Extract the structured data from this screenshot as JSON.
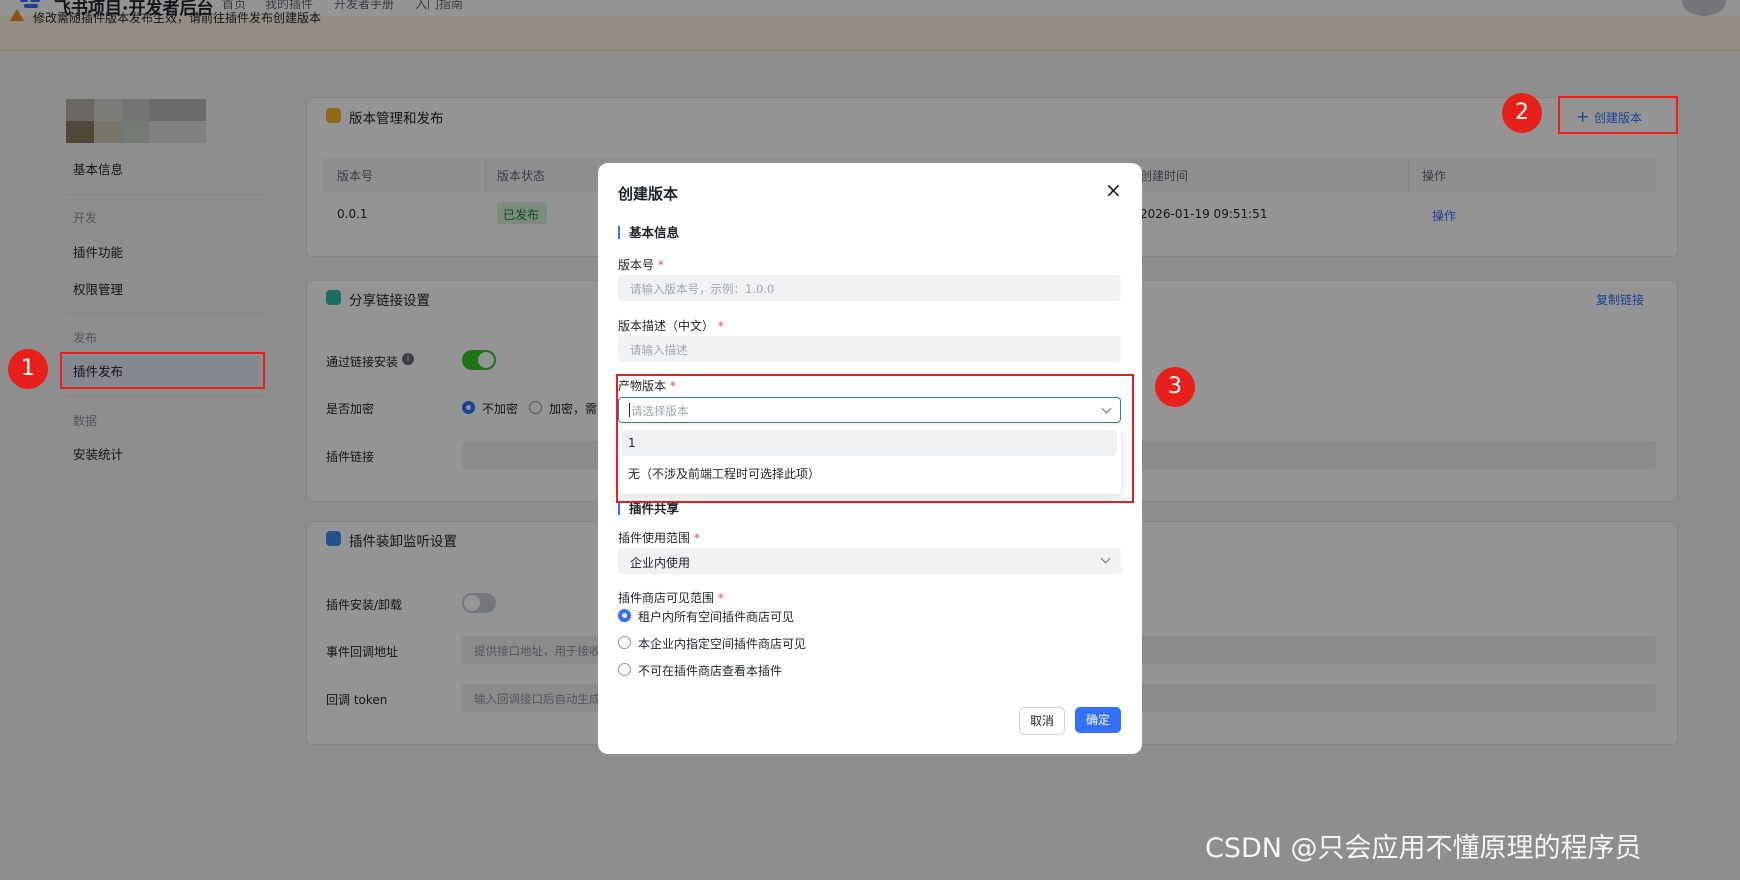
{
  "header": {
    "app_title": "飞书项目·开发者后台",
    "nav": [
      "首页",
      "我的插件",
      "开发者手册",
      "入门指南"
    ]
  },
  "notice": {
    "text": "修改需随插件版本发布生效，请前往插件发布创建版本"
  },
  "sidebar": {
    "basic_info": "基本信息",
    "group_dev": "开发",
    "plugin_function": "插件功能",
    "permission": "权限管理",
    "group_publish": "发布",
    "plugin_publish": "插件发布",
    "group_data": "数据",
    "install_stats": "安装统计"
  },
  "version_card": {
    "title": "版本管理和发布",
    "create_button": "创建版本",
    "columns": [
      "版本号",
      "版本状态",
      "创建时间",
      "操作"
    ],
    "row": {
      "version": "0.0.1",
      "status": "已发布",
      "created": "2026-01-19 09:51:51",
      "action": "操作"
    }
  },
  "share_card": {
    "title": "分享链接设置",
    "copy_link": "复制链接",
    "install_via_link": "通过链接安装",
    "encrypt_label": "是否加密",
    "opt_no_encrypt": "不加密",
    "opt_encrypt": "加密，需",
    "plugin_link": "插件链接"
  },
  "listen_card": {
    "title": "插件装卸监听设置",
    "install_uninstall": "插件安装/卸载",
    "callback_url": "事件回调地址",
    "callback_url_ph": "提供接口地址，用于接收",
    "callback_token": "回调 token",
    "callback_token_ph": "输入回调接口后自动生成"
  },
  "modal": {
    "title": "创建版本",
    "section_basic": "基本信息",
    "version_label": "版本号",
    "version_ph": "请输入版本号，示例：1.0.0",
    "desc_label": "版本描述（中文）",
    "desc_ph": "请输入描述",
    "artifact_label": "产物版本",
    "artifact_ph": "请选择版本",
    "options": [
      "1",
      "无（不涉及前端工程时可选择此项）"
    ],
    "section_share": "插件共享",
    "scope_label": "插件使用范围",
    "scope_value": "企业内使用",
    "visible_label": "插件商店可见范围",
    "visible_options": [
      "租户内所有空间插件商店可见",
      "本企业内指定空间插件商店可见",
      "不可在插件商店查看本插件"
    ],
    "cancel": "取消",
    "confirm": "确定"
  },
  "annotations": {
    "badge1": "1",
    "badge2": "2",
    "badge3": "3"
  },
  "watermark": "CSDN @只会应用不懂原理的程序员",
  "colors": {
    "accent": "#3370ff",
    "annotation_red": "#e8201c",
    "toggle_on": "#34c724",
    "notice_bg": "#fdf3e2"
  }
}
